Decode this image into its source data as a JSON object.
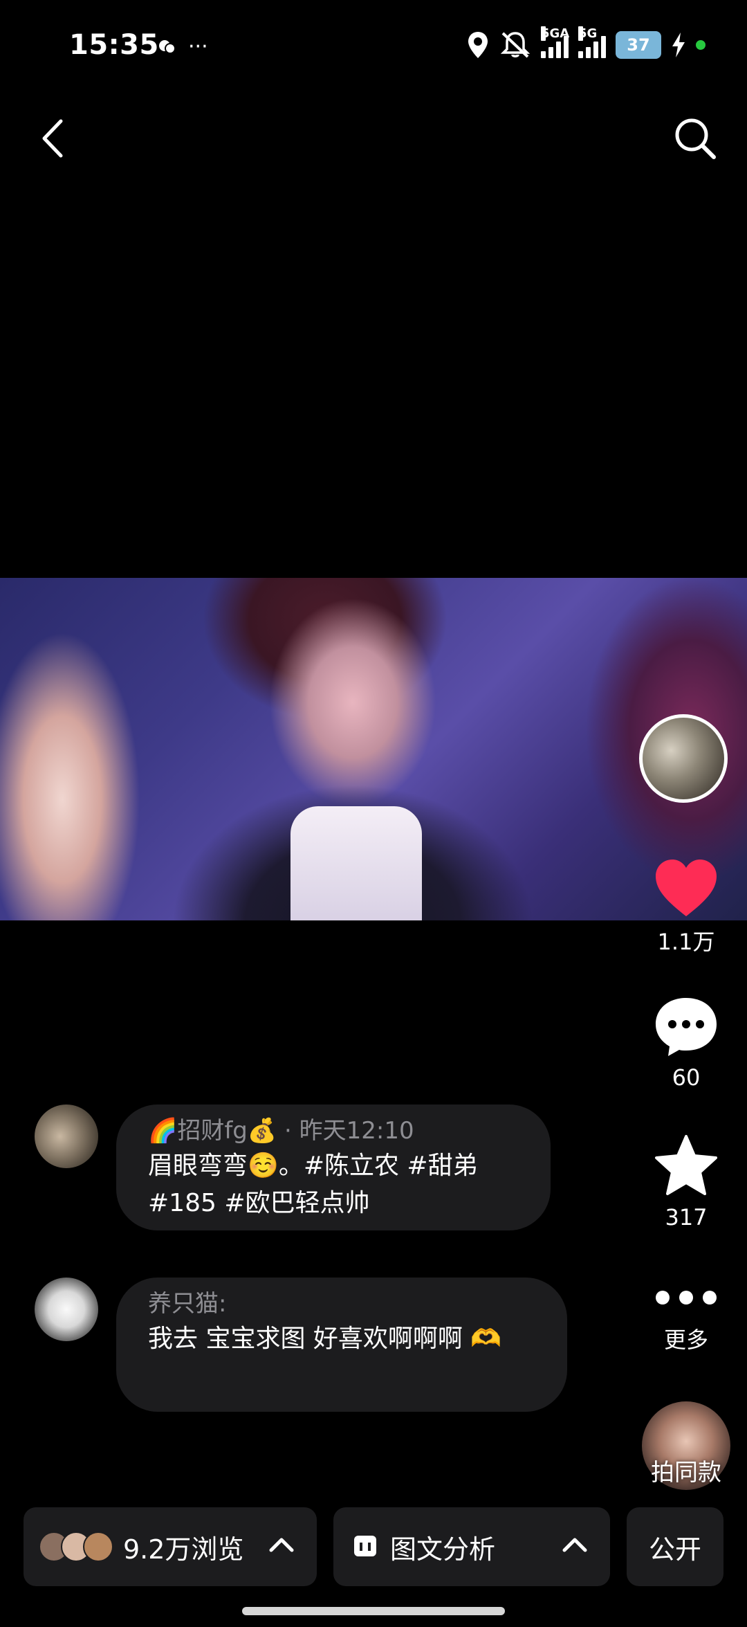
{
  "status_bar": {
    "time": "15:35",
    "misc_icons": [
      "wechat-mini-icon",
      "more-dots"
    ],
    "more_dots": "···",
    "net1": "5GA",
    "net2": "5G",
    "battery": "37"
  },
  "nav": {
    "back_icon": "chevron-left-icon",
    "search_icon": "search-icon"
  },
  "rail": {
    "likes": "1.1万",
    "comments": "60",
    "favorites": "317",
    "more_label": "更多",
    "same_style_label": "拍同款",
    "like_color": "#fe2c55"
  },
  "comments": [
    {
      "author": "🌈招财fg💰",
      "separator": " · ",
      "time": "昨天12:10",
      "text": "眉眼弯弯☺️。#陈立农 #甜弟 #185 #欧巴轻点帅"
    },
    {
      "author": "养只猫:",
      "text": "我去 宝宝求图 好喜欢啊啊啊 🫶"
    }
  ],
  "bottom_bar": {
    "views": "9.2万浏览",
    "analysis": "图文分析",
    "public": "公开"
  }
}
